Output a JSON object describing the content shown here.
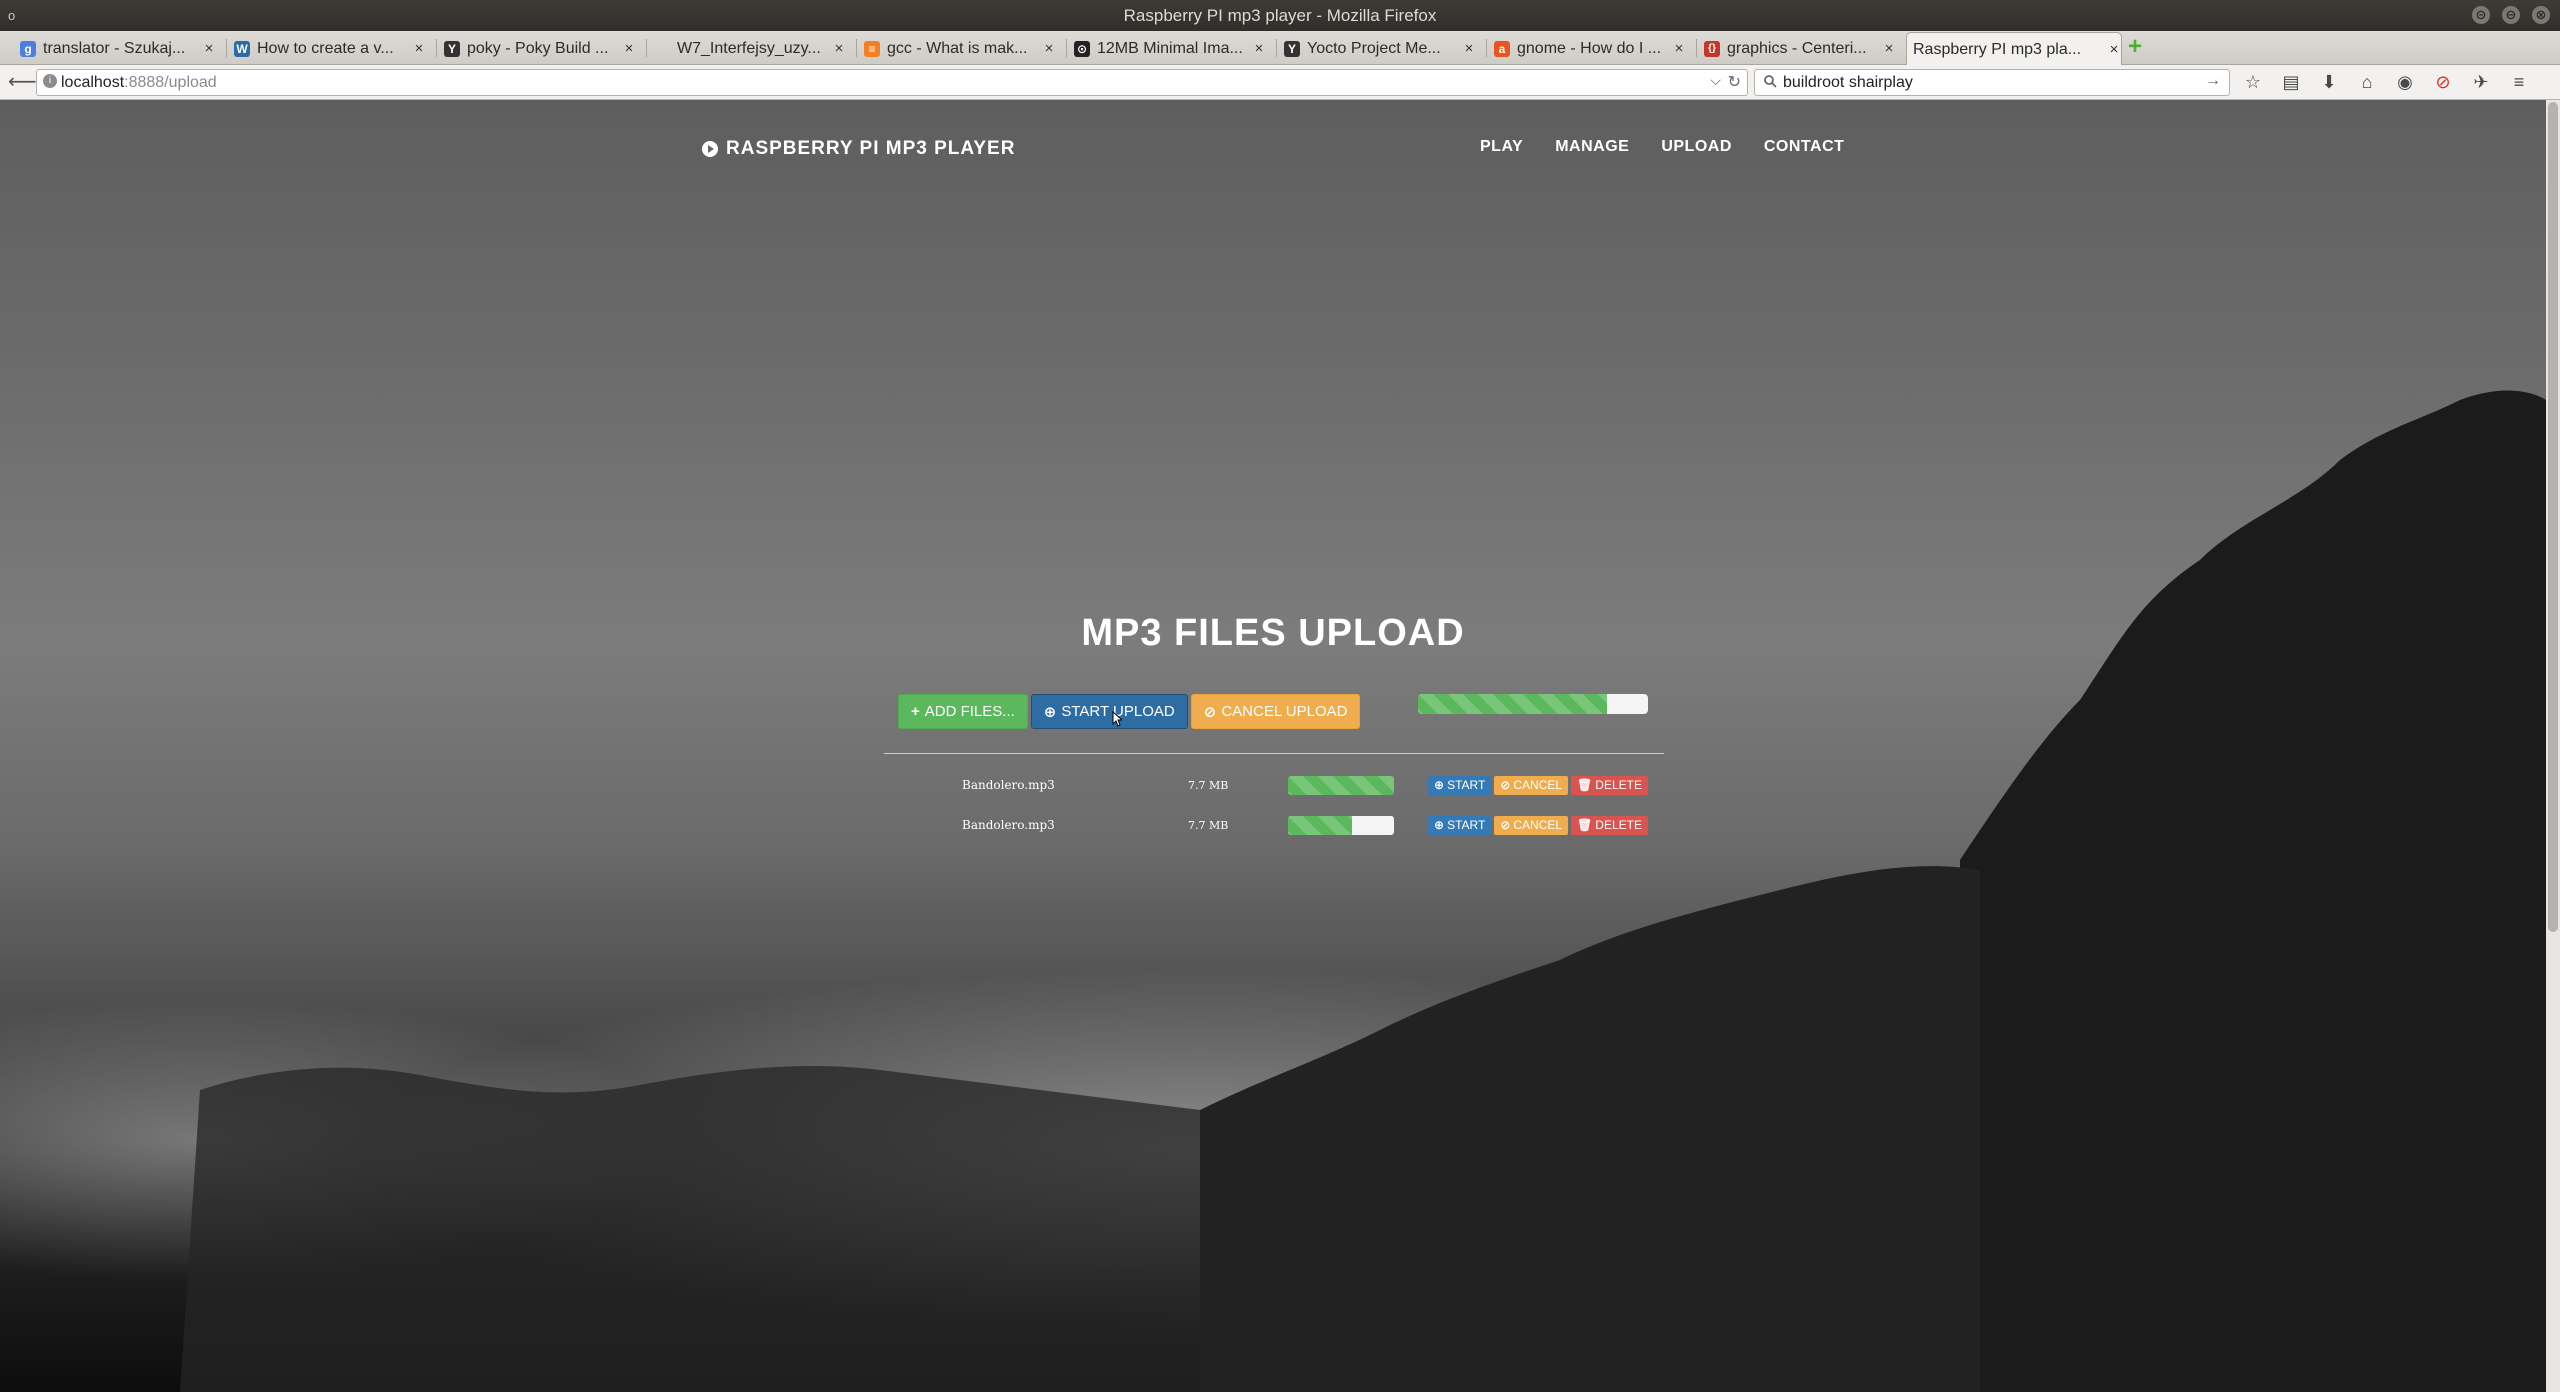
{
  "window": {
    "title": "Raspberry PI mp3 player - Mozilla Firefox",
    "corner_glyph": "o",
    "controls": {
      "minimize": "⊝",
      "maximize": "⊖",
      "close": "⊗"
    }
  },
  "tabs": [
    {
      "label": "translator - Szukaj...",
      "favicon": "google-icon",
      "fav_color": "#4a7fe0",
      "fav_glyph": "g"
    },
    {
      "label": "How to create a v...",
      "favicon": "wordpress-icon",
      "fav_color": "#2a6ca5",
      "fav_glyph": "W"
    },
    {
      "label": "poky - Poky Build ...",
      "favicon": "yocto-icon",
      "fav_color": "#333",
      "fav_glyph": "Y"
    },
    {
      "label": "W7_Interfejsy_uzy...",
      "favicon": "blank-icon",
      "fav_color": "transparent",
      "fav_glyph": ""
    },
    {
      "label": "gcc - What is mak...",
      "favicon": "stackoverflow-icon",
      "fav_color": "#f48024",
      "fav_glyph": "≡"
    },
    {
      "label": "12MB Minimal Ima...",
      "favicon": "github-icon",
      "fav_color": "#222",
      "fav_glyph": "⊙"
    },
    {
      "label": "Yocto Project Me...",
      "favicon": "yocto-icon",
      "fav_color": "#333",
      "fav_glyph": "Y"
    },
    {
      "label": "gnome - How do I ...",
      "favicon": "askubuntu-icon",
      "fav_color": "#e95420",
      "fav_glyph": "a"
    },
    {
      "label": "graphics - Centeri...",
      "favicon": "tex-icon",
      "fav_color": "#c0392b",
      "fav_glyph": "{}"
    },
    {
      "label": "Raspberry PI mp3 pla...",
      "favicon": "none",
      "fav_color": "transparent",
      "fav_glyph": ""
    }
  ],
  "tab_close_glyph": "×",
  "new_tab_glyph": "+",
  "nav": {
    "back_glyph": "⟵",
    "url_host": "localhost",
    "url_path": ":8888/upload",
    "search_value": "buildroot shairplay",
    "url_drop_glyph": "⌵",
    "reload_glyph": "↻",
    "search_go_glyph": "→",
    "toolbar_glyphs": {
      "bookmark": "☆",
      "reading_list": "▤",
      "download": "⬇",
      "home": "⌂",
      "chat": "◉",
      "adblock": "⊘",
      "extension": "✈",
      "menu": "≡"
    }
  },
  "site": {
    "brand": "RASPBERRY PI MP3 PLAYER",
    "nav_links": [
      "PLAY",
      "MANAGE",
      "UPLOAD",
      "CONTACT"
    ],
    "heading": "MP3 FILES UPLOAD",
    "buttons": {
      "add_files": "ADD FILES...",
      "start_upload": "START UPLOAD",
      "cancel_upload": "CANCEL UPLOAD",
      "add_glyph": "+",
      "start_glyph": "⊕",
      "cancel_glyph": "⊘"
    },
    "global_progress": 0.82,
    "files": [
      {
        "name": "Bandolero.mp3",
        "size": "7.7 MB",
        "progress": 1.0
      },
      {
        "name": "Bandolero.mp3",
        "size": "7.7 MB",
        "progress": 0.6
      }
    ],
    "row_buttons": {
      "start": "START",
      "cancel": "CANCEL",
      "delete": "DELETE",
      "start_glyph": "⊕",
      "cancel_glyph": "⊘",
      "delete_glyph": "🗑"
    }
  },
  "colors": {
    "green": "#5cb85c",
    "blue": "#2e6da4",
    "orange": "#f0ad4e",
    "red": "#d9534f"
  }
}
